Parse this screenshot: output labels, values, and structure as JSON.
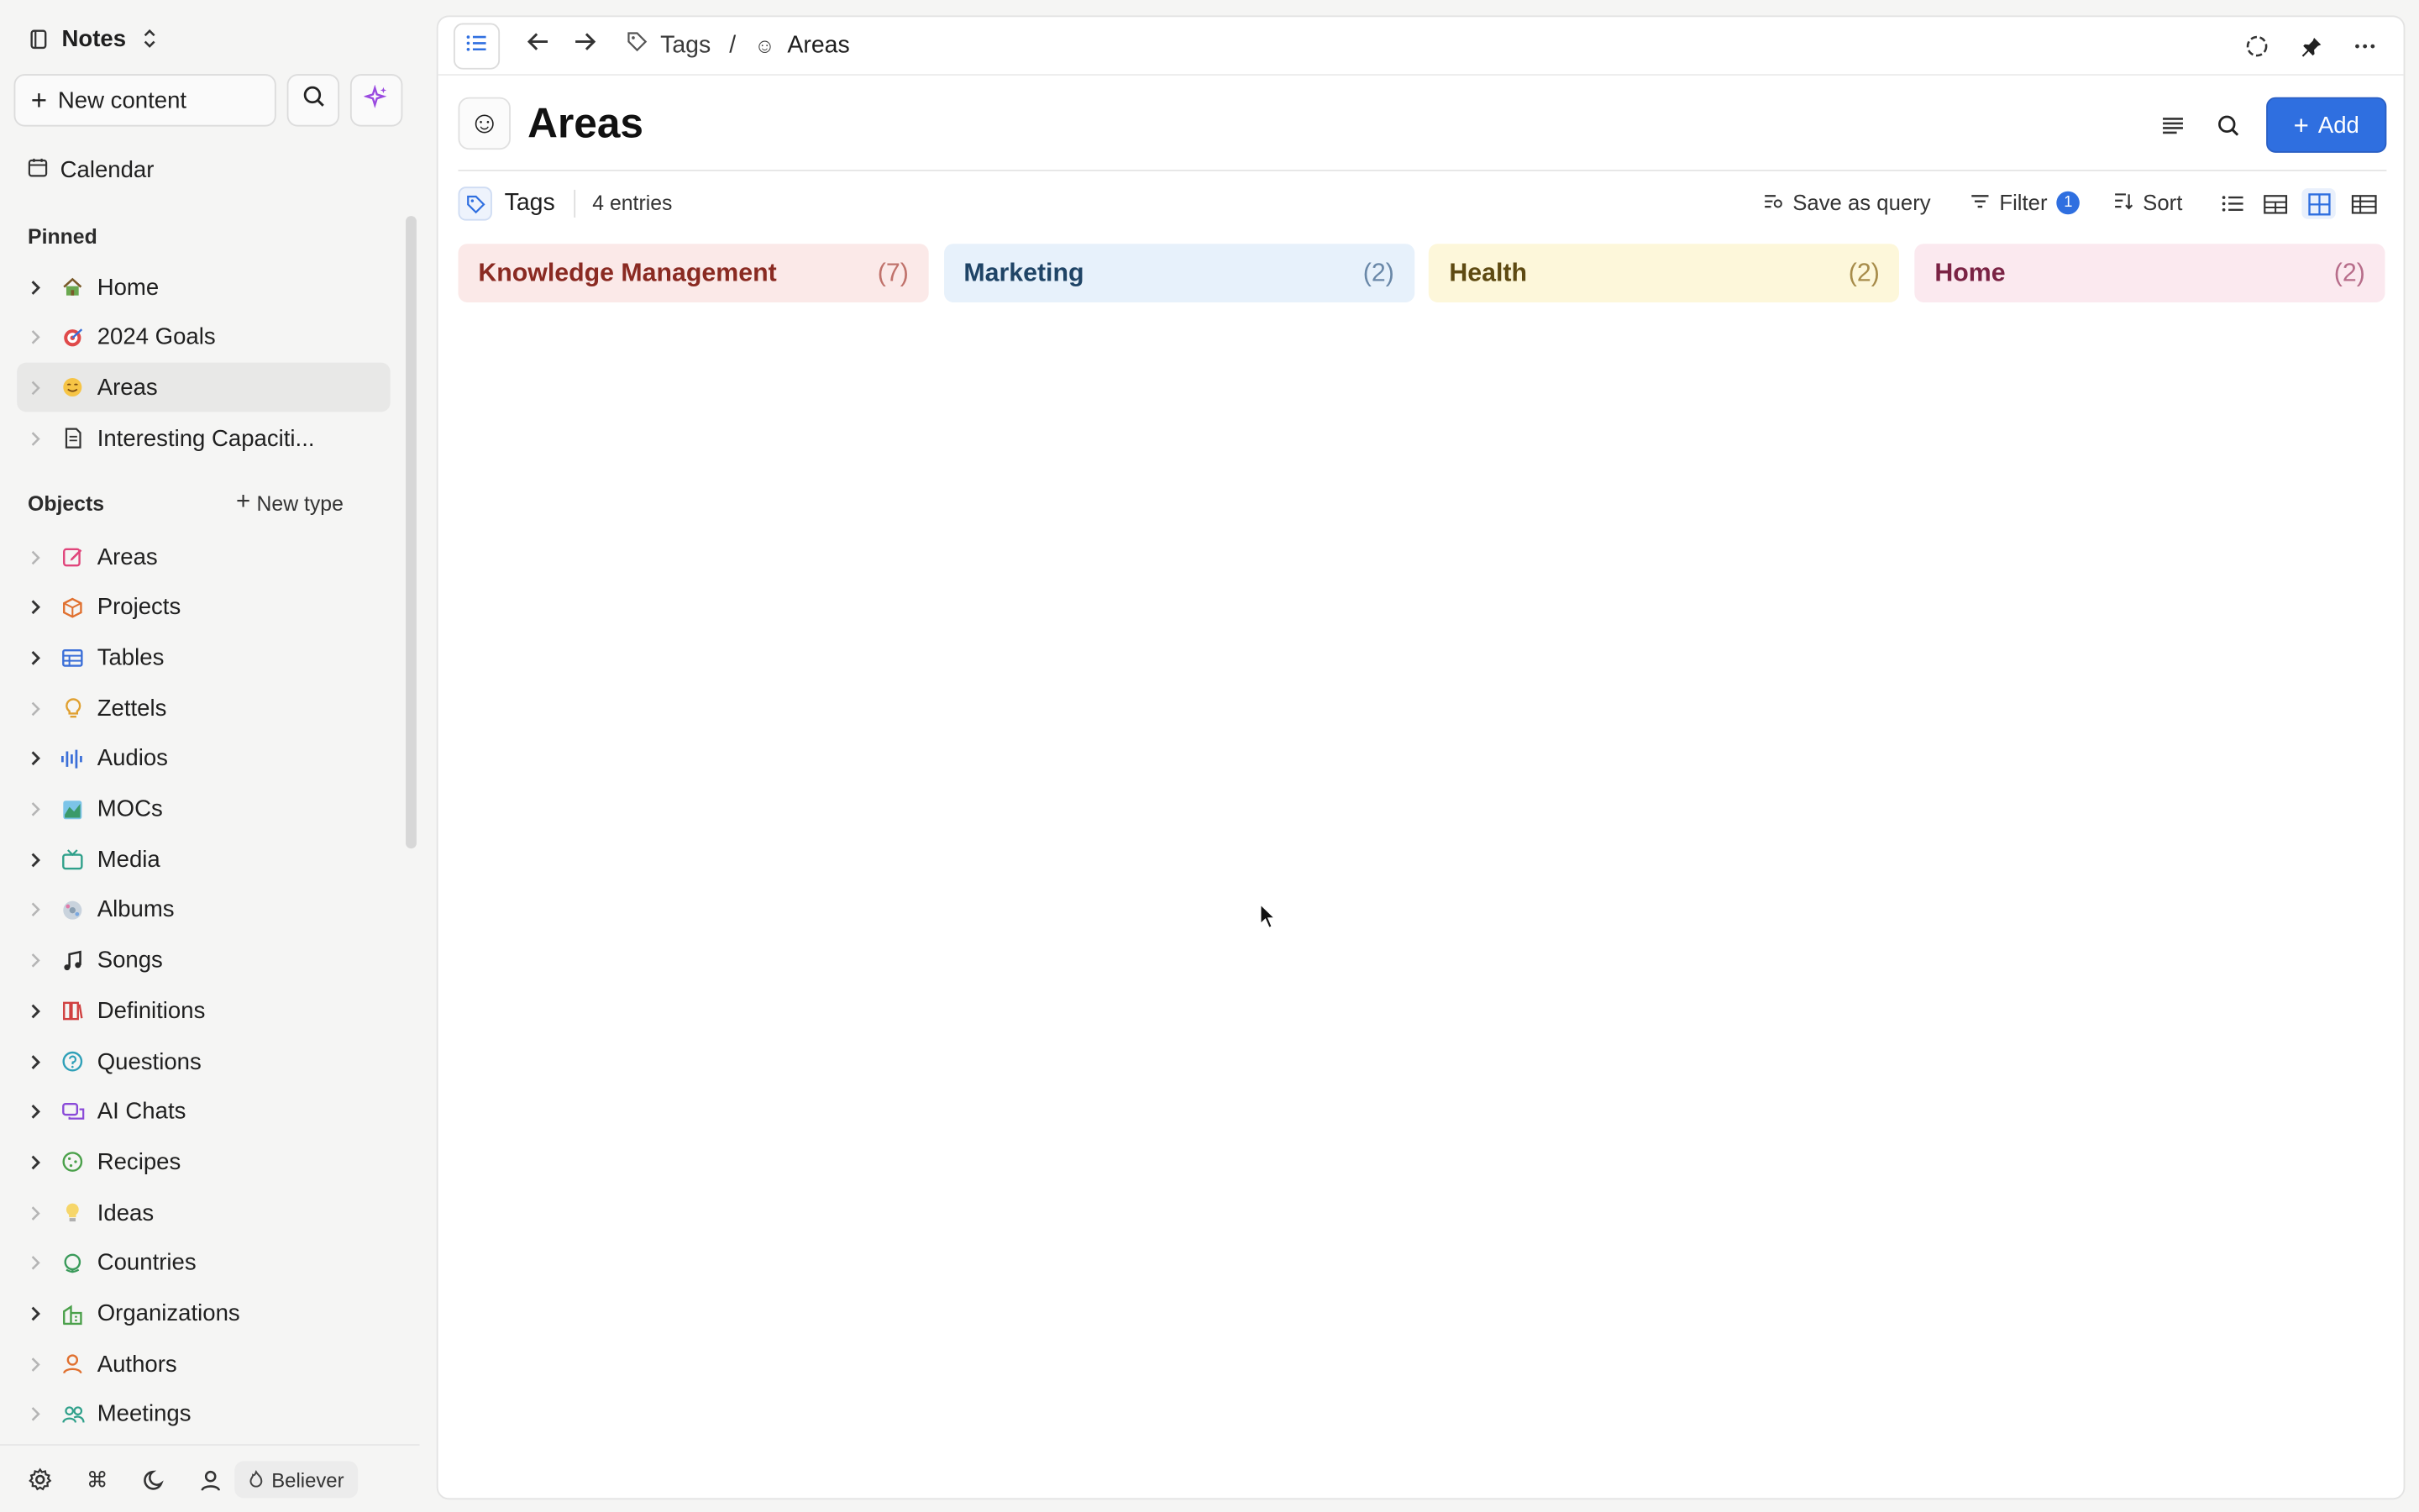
{
  "workspace": {
    "title": "Notes"
  },
  "sidebar": {
    "new_content_label": "New content",
    "calendar_label": "Calendar",
    "pinned_label": "Pinned",
    "pinned": [
      {
        "label": "Home",
        "icon": "house-icon",
        "bold_chevron": true
      },
      {
        "label": "2024 Goals",
        "icon": "target-icon",
        "bold_chevron": false
      },
      {
        "label": "Areas",
        "icon": "smiley-icon",
        "bold_chevron": false,
        "active": true
      },
      {
        "label": "Interesting Capaciti...",
        "icon": "document-icon",
        "bold_chevron": false
      }
    ],
    "objects_label": "Objects",
    "new_type_label": "New type",
    "objects": [
      {
        "label": "Areas",
        "icon": "edit-icon",
        "color": "#e0457b",
        "bold_chevron": false
      },
      {
        "label": "Projects",
        "icon": "cube-icon",
        "color": "#e0702f",
        "bold_chevron": true
      },
      {
        "label": "Tables",
        "icon": "table-icon",
        "color": "#3b6fd8",
        "bold_chevron": true
      },
      {
        "label": "Zettels",
        "icon": "lightbulb-icon",
        "color": "#e0a030",
        "bold_chevron": false
      },
      {
        "label": "Audios",
        "icon": "waveform-icon",
        "color": "#3b6fd8",
        "bold_chevron": true
      },
      {
        "label": "MOCs",
        "icon": "map-icon",
        "color": "#3a9a6a",
        "bold_chevron": false
      },
      {
        "label": "Media",
        "icon": "tv-icon",
        "color": "#2fa08a",
        "bold_chevron": true
      },
      {
        "label": "Albums",
        "icon": "album-icon",
        "color": "#8a8a8a",
        "bold_chevron": false
      },
      {
        "label": "Songs",
        "icon": "music-icon",
        "color": "#2b2b2b",
        "bold_chevron": false
      },
      {
        "label": "Definitions",
        "icon": "books-icon",
        "color": "#d04040",
        "bold_chevron": true
      },
      {
        "label": "Questions",
        "icon": "question-icon",
        "color": "#2fa0b8",
        "bold_chevron": true
      },
      {
        "label": "AI Chats",
        "icon": "chat-icon",
        "color": "#8a4ad8",
        "bold_chevron": true
      },
      {
        "label": "Recipes",
        "icon": "cookie-icon",
        "color": "#4aa04a",
        "bold_chevron": true
      },
      {
        "label": "Ideas",
        "icon": "bulb-icon",
        "color": "#e0b030",
        "bold_chevron": false
      },
      {
        "label": "Countries",
        "icon": "globe-icon",
        "color": "#3a9a5a",
        "bold_chevron": false
      },
      {
        "label": "Organizations",
        "icon": "building-icon",
        "color": "#4aa04a",
        "bold_chevron": true
      },
      {
        "label": "Authors",
        "icon": "person-icon",
        "color": "#e0702f",
        "bold_chevron": false
      },
      {
        "label": "Meetings",
        "icon": "people-icon",
        "color": "#2fa08a",
        "bold_chevron": false
      }
    ],
    "footer_badge": "Believer"
  },
  "topbar": {
    "breadcrumbs": [
      "Tags",
      "Areas"
    ]
  },
  "page": {
    "title": "Areas",
    "add_label": "Add"
  },
  "query_bar": {
    "source_label": "Tags",
    "entries_label": "4 entries",
    "save_as_query_label": "Save as query",
    "filter_label": "Filter",
    "filter_count": "1",
    "sort_label": "Sort"
  },
  "cards": [
    {
      "name": "Knowledge Management",
      "count": "(7)",
      "bg": "#fbe9e8",
      "fg": "#8a2a22",
      "count_fg": "#c0726b"
    },
    {
      "name": "Marketing",
      "count": "(2)",
      "bg": "#e7f1fb",
      "fg": "#1f4466",
      "count_fg": "#6a88a8"
    },
    {
      "name": "Health",
      "count": "(2)",
      "bg": "#fdf7da",
      "fg": "#5e4a12",
      "count_fg": "#a78c4a"
    },
    {
      "name": "Home",
      "count": "(2)",
      "bg": "#fbe9ef",
      "fg": "#7a2344",
      "count_fg": "#b76d8a"
    }
  ]
}
